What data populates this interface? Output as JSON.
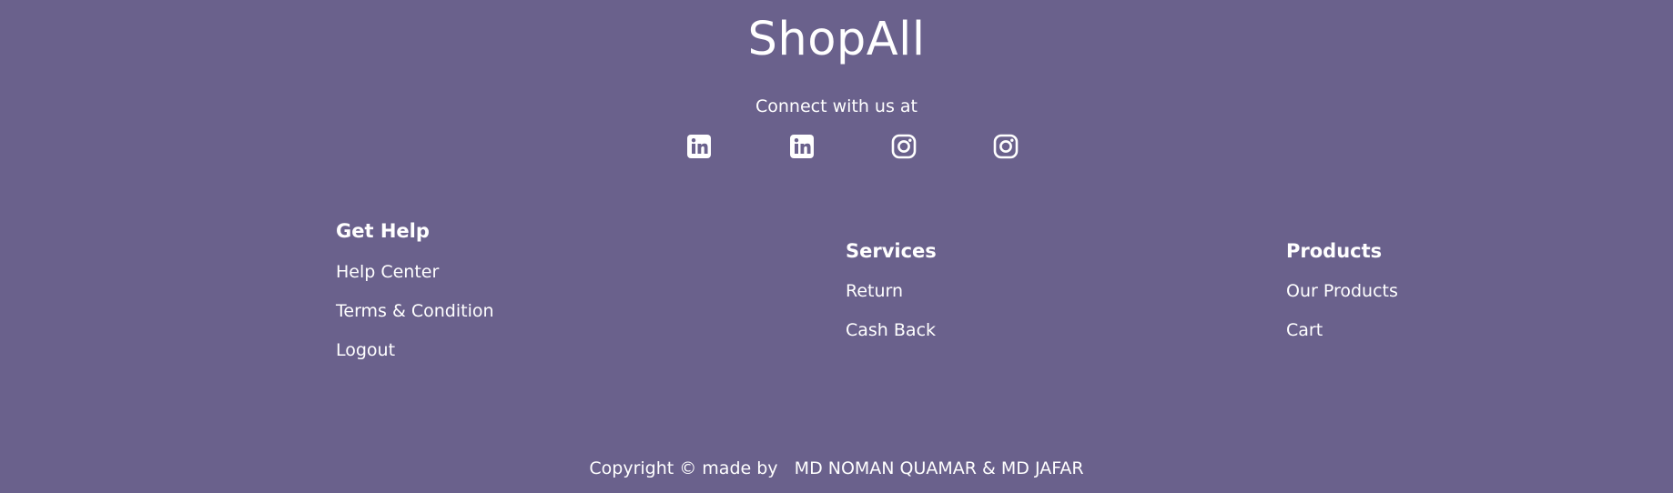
{
  "brand": {
    "name": "ShopAll"
  },
  "connect": {
    "text": "Connect with us at",
    "icons": [
      "linkedin-icon",
      "linkedin-icon",
      "instagram-icon",
      "instagram-icon"
    ]
  },
  "columns": {
    "help": {
      "title": "Get Help",
      "links": [
        "Help Center",
        "Terms & Condition",
        "Logout"
      ]
    },
    "services": {
      "title": "Services",
      "links": [
        "Return",
        "Cash Back"
      ]
    },
    "products": {
      "title": "Products",
      "links": [
        "Our Products",
        "Cart"
      ]
    }
  },
  "copyright": {
    "prefix": "Copyright © made by",
    "authors": "MD NOMAN QUAMAR & MD JAFAR"
  },
  "colors": {
    "background": "#6a618c",
    "text": "#ffffff"
  }
}
